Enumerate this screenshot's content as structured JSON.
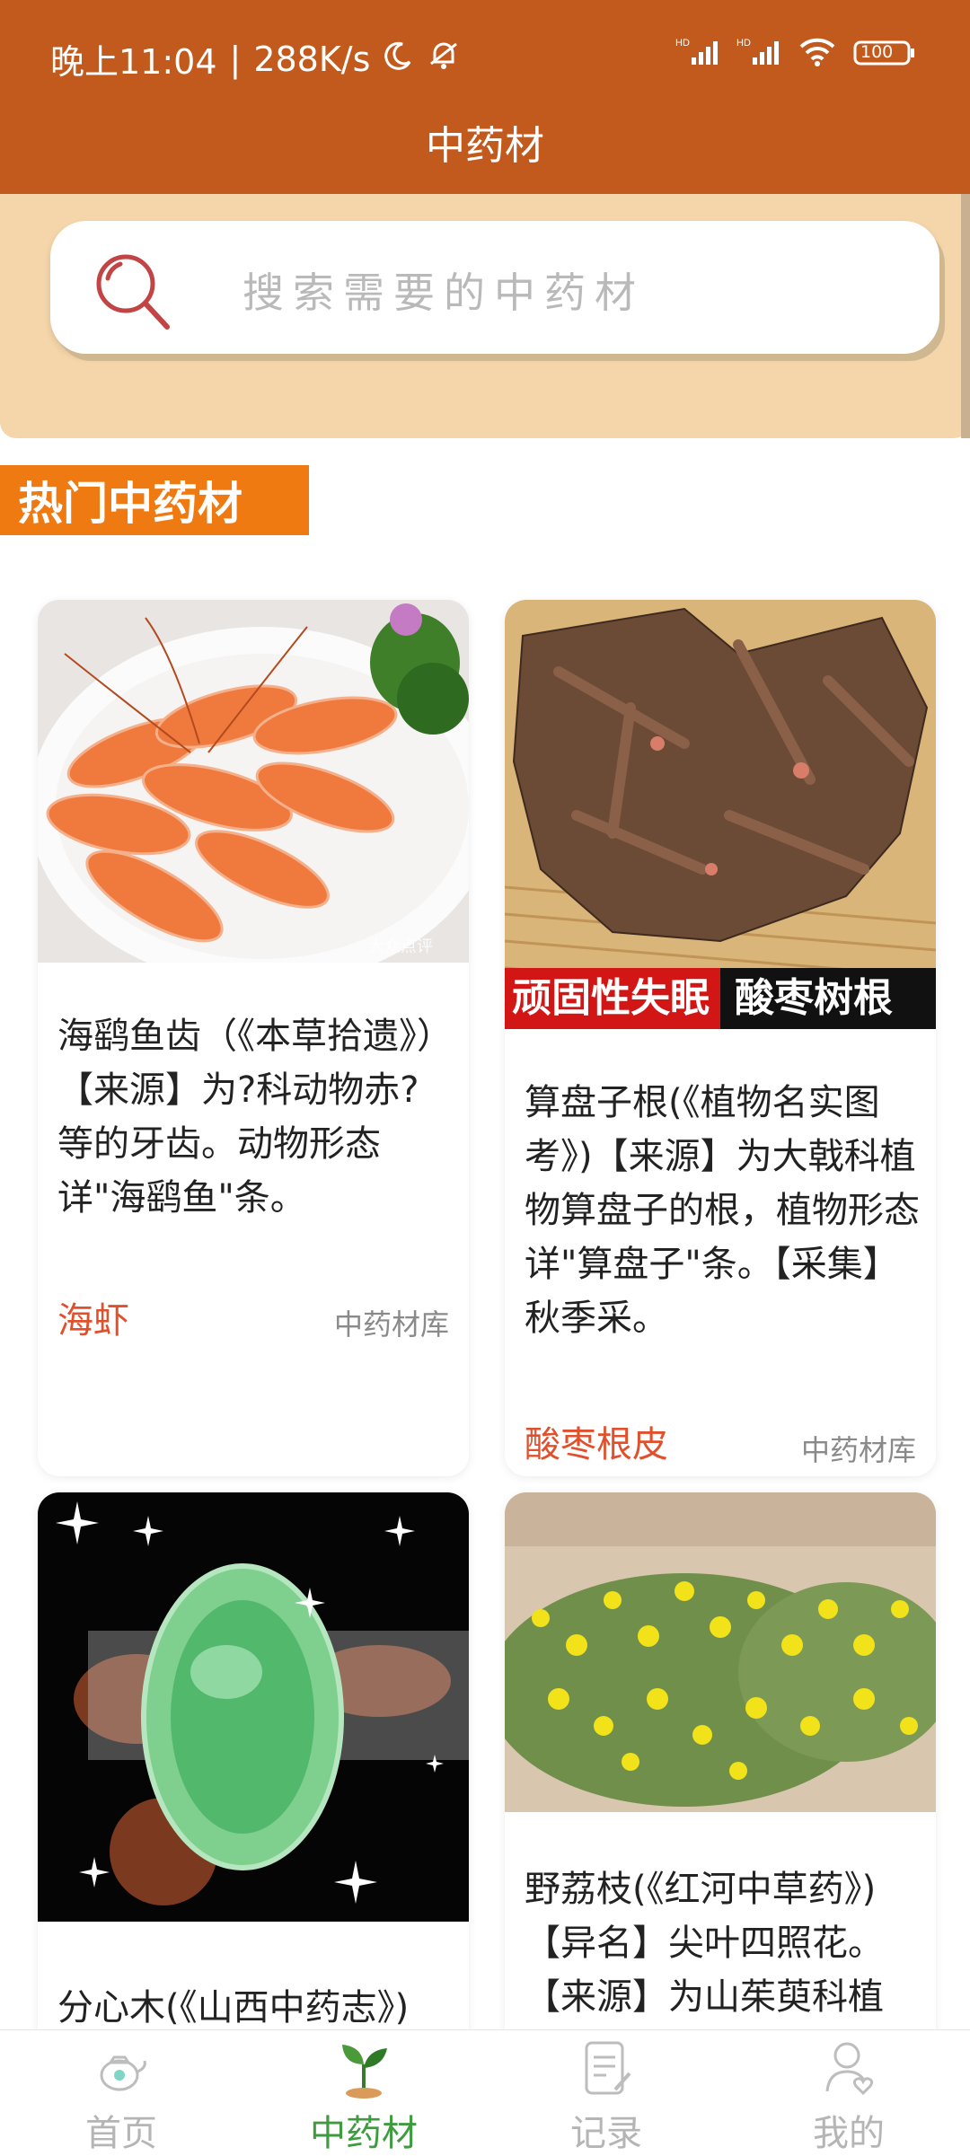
{
  "status": {
    "time": "晚上11:04",
    "speed": "288K/s",
    "network1": "HD",
    "network2": "HD",
    "battery": "100"
  },
  "header": {
    "title": "中药材"
  },
  "search": {
    "placeholder": "搜索需要的中药材"
  },
  "section": {
    "title": "热门中药材"
  },
  "cards": [
    {
      "desc": "海鹞鱼齿（《本草拾遗》）【来源】为?科动物赤?等的牙齿。动物形态详\"海鹞鱼\"条。",
      "name": "海虾",
      "source": "中药材库",
      "watermark": "大众点评"
    },
    {
      "overlay_left": "顽固性失眠",
      "overlay_right": "酸枣树根",
      "desc": "算盘子根(《植物名实图考》)【来源】为大戟科植物算盘子的根，植物形态详\"算盘子\"条。【采集】秋季采。",
      "name": "酸枣根皮",
      "source": "中药材库"
    },
    {
      "desc": "分心木(《山西中药志》)",
      "name": "",
      "source": ""
    },
    {
      "desc": "野荔枝(《红河中草药》)【异名】尖叶四照花。【来源】为山茱萸科植",
      "name": "",
      "source": ""
    }
  ],
  "nav": [
    {
      "label": "首页",
      "icon": "teapot-icon"
    },
    {
      "label": "中药材",
      "icon": "sprout-icon"
    },
    {
      "label": "记录",
      "icon": "note-icon"
    },
    {
      "label": "我的",
      "icon": "user-heart-icon"
    }
  ],
  "colors": {
    "header": "#c35a1d",
    "search_panel": "#f5d6aa",
    "section_title": "#f07a12",
    "herb_name": "#e0502c",
    "nav_active": "#3f9b3f",
    "nav_inactive": "#b5b5b5"
  }
}
